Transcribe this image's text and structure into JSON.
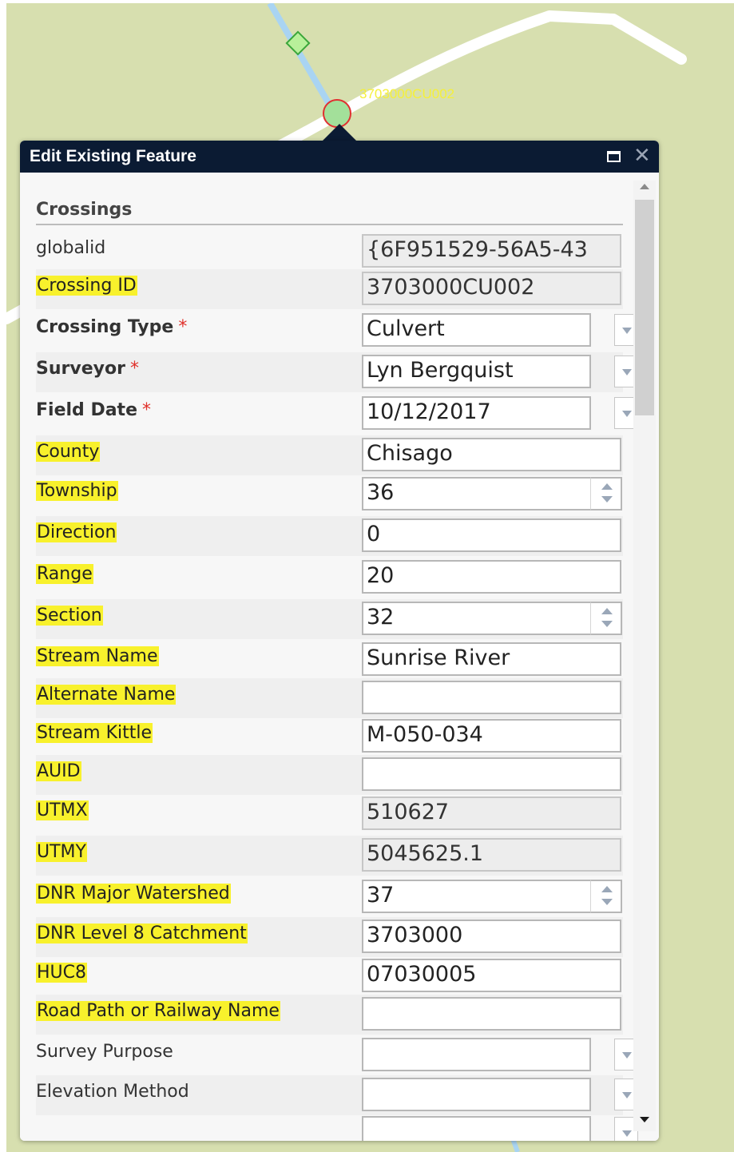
{
  "map": {
    "feature_label": "3703000CU002"
  },
  "popup": {
    "title": "Edit Existing Feature",
    "section": "Crossings",
    "fields": [
      {
        "label": "globalid",
        "value": "{6F951529-56A5-43",
        "kind": "readonly",
        "style": "plain"
      },
      {
        "label": "Crossing ID",
        "value": "3703000CU002",
        "kind": "readonly",
        "style": "highlight"
      },
      {
        "label": "Crossing Type",
        "value": "Culvert",
        "kind": "select",
        "style": "bold",
        "required": "*"
      },
      {
        "label": "Surveyor",
        "value": "Lyn Bergquist",
        "kind": "select",
        "style": "bold",
        "required": "*"
      },
      {
        "label": "Field Date",
        "value": "10/12/2017",
        "kind": "select",
        "style": "bold",
        "required": "*"
      },
      {
        "label": "County",
        "value": "Chisago",
        "kind": "text",
        "style": "highlight"
      },
      {
        "label": "Township",
        "value": "36",
        "kind": "spin",
        "style": "highlight"
      },
      {
        "label": "Direction",
        "value": "0",
        "kind": "text",
        "style": "highlight"
      },
      {
        "label": "Range",
        "value": "20",
        "kind": "text",
        "style": "highlight"
      },
      {
        "label": "Section",
        "value": "32",
        "kind": "spin",
        "style": "highlight"
      },
      {
        "label": "Stream Name",
        "value": "Sunrise River",
        "kind": "text",
        "style": "highlight"
      },
      {
        "label": "Alternate Name",
        "value": "",
        "kind": "text",
        "style": "highlight"
      },
      {
        "label": "Stream Kittle",
        "value": "M-050-034",
        "kind": "text",
        "style": "highlight"
      },
      {
        "label": "AUID",
        "value": "",
        "kind": "text",
        "style": "highlight"
      },
      {
        "label": "UTMX",
        "value": "510627",
        "kind": "readonly",
        "style": "highlight"
      },
      {
        "label": "UTMY",
        "value": "5045625.1",
        "kind": "readonly",
        "style": "highlight"
      },
      {
        "label": "DNR Major Watershed",
        "value": "37",
        "kind": "spin",
        "style": "highlight"
      },
      {
        "label": "DNR Level 8 Catchment",
        "value": "3703000",
        "kind": "text",
        "style": "highlight"
      },
      {
        "label": "HUC8",
        "value": "07030005",
        "kind": "text",
        "style": "highlight"
      },
      {
        "label": "Road Path or Railway Name",
        "value": "",
        "kind": "text",
        "style": "highlight"
      },
      {
        "label": "Survey Purpose",
        "value": "",
        "kind": "select",
        "style": "plain"
      },
      {
        "label": "Elevation Method",
        "value": "",
        "kind": "select",
        "style": "plain"
      },
      {
        "label": "",
        "value": "",
        "kind": "select",
        "style": "plain"
      }
    ]
  },
  "colors": {
    "titlebar": "#0b1b33",
    "highlight": "#f8f12c",
    "required": "#e0302a",
    "map_bg": "#d7dfaf",
    "feature_label": "#f5f03a"
  }
}
